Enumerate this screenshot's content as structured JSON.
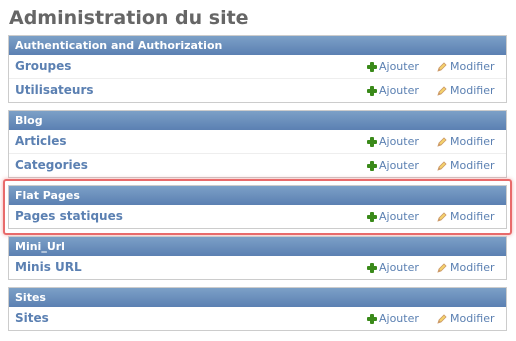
{
  "page": {
    "title": "Administration du site"
  },
  "actions": {
    "add_label": "Ajouter",
    "change_label": "Modifier"
  },
  "colors": {
    "header": "#5b80b2",
    "link": "#5b80b2",
    "add_icon": "#3a8a1a",
    "highlight": "#e86b6b"
  },
  "modules": [
    {
      "name": "Authentication and Authorization",
      "rows": [
        "Groupes",
        "Utilisateurs"
      ]
    },
    {
      "name": "Blog",
      "rows": [
        "Articles",
        "Categories"
      ]
    },
    {
      "name": "Flat Pages",
      "rows": [
        "Pages statiques"
      ]
    },
    {
      "name": "Mini_Url",
      "rows": [
        "Minis URL"
      ]
    },
    {
      "name": "Sites",
      "rows": [
        "Sites"
      ]
    }
  ],
  "highlighted_module": "Flat Pages"
}
